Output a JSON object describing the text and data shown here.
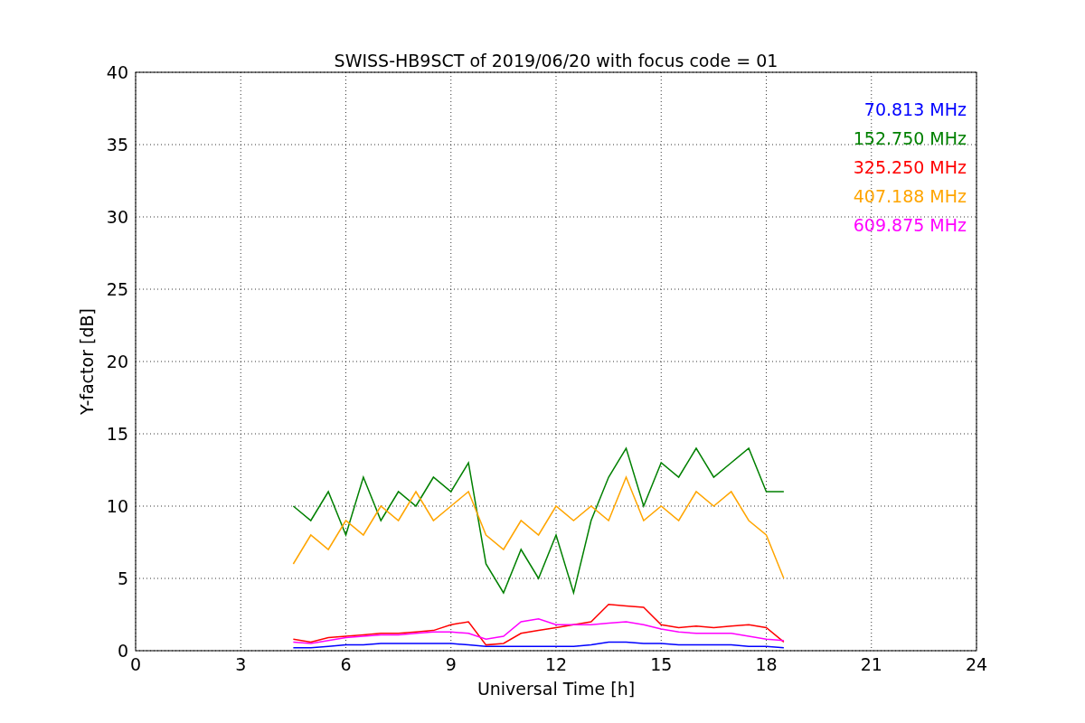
{
  "chart_data": {
    "type": "line",
    "title": "SWISS-HB9SCT of 2019/06/20 with focus code = 01",
    "xlabel": "Universal Time [h]",
    "ylabel": "Y-factor [dB]",
    "grid": true,
    "xlim": [
      0,
      24
    ],
    "ylim": [
      0,
      40
    ],
    "xticks": [
      0,
      3,
      6,
      9,
      12,
      15,
      18,
      21,
      24
    ],
    "yticks": [
      0,
      5,
      10,
      15,
      20,
      25,
      30,
      35,
      40
    ],
    "x": [
      4.5,
      5,
      5.5,
      6,
      6.5,
      7,
      7.5,
      8,
      8.5,
      9,
      9.5,
      10,
      10.5,
      11,
      11.5,
      12,
      12.5,
      13,
      13.5,
      14,
      14.5,
      15,
      15.5,
      16,
      16.5,
      17,
      17.5,
      18,
      18.5
    ],
    "series": [
      {
        "name": "70.813 MHz",
        "color": "#0000ff",
        "values": [
          0.2,
          0.2,
          0.3,
          0.4,
          0.4,
          0.5,
          0.5,
          0.5,
          0.5,
          0.5,
          0.4,
          0.3,
          0.3,
          0.3,
          0.3,
          0.3,
          0.3,
          0.4,
          0.6,
          0.6,
          0.5,
          0.5,
          0.4,
          0.4,
          0.4,
          0.4,
          0.3,
          0.3,
          0.2
        ]
      },
      {
        "name": "152.750 MHz",
        "color": "#008000",
        "values": [
          10,
          9,
          11,
          8,
          12,
          9,
          11,
          10,
          12,
          11,
          13,
          6,
          4,
          7,
          5,
          8,
          4,
          9,
          12,
          14,
          10,
          13,
          12,
          14,
          12,
          13,
          14,
          11,
          11
        ]
      },
      {
        "name": "325.250 MHz",
        "color": "#ff0000",
        "values": [
          0.8,
          0.6,
          0.9,
          1,
          1.1,
          1.2,
          1.2,
          1.3,
          1.4,
          1.8,
          2,
          0.4,
          0.5,
          1.2,
          1.4,
          1.6,
          1.8,
          2,
          3.2,
          3.1,
          3,
          1.8,
          1.6,
          1.7,
          1.6,
          1.7,
          1.8,
          1.6,
          0.6
        ]
      },
      {
        "name": "407.188 MHz",
        "color": "#ffa500",
        "values": [
          6,
          8,
          7,
          9,
          8,
          10,
          9,
          11,
          9,
          10,
          11,
          8,
          7,
          9,
          8,
          10,
          9,
          10,
          9,
          12,
          9,
          10,
          9,
          11,
          10,
          11,
          9,
          8,
          5
        ]
      },
      {
        "name": "609.875 MHz",
        "color": "#ff00ff",
        "values": [
          0.6,
          0.5,
          0.7,
          0.9,
          1,
          1.1,
          1.1,
          1.2,
          1.3,
          1.3,
          1.2,
          0.8,
          1,
          2,
          2.2,
          1.8,
          1.8,
          1.8,
          1.9,
          2,
          1.8,
          1.5,
          1.3,
          1.2,
          1.2,
          1.2,
          1,
          0.8,
          0.7
        ]
      }
    ]
  }
}
